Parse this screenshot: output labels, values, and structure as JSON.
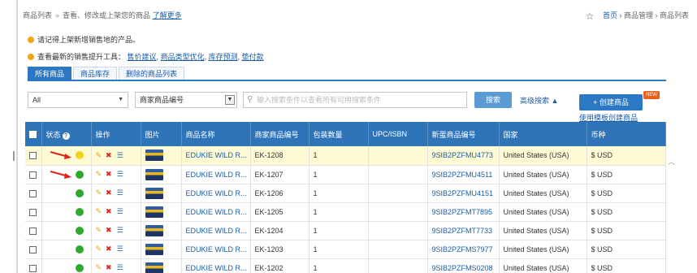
{
  "breadcrumb": {
    "section": "商品列表",
    "description": "查看、修改或上架您的商品",
    "learn_more": "了解更多",
    "home": "首页",
    "parent": "商品管理",
    "current": "商品列表"
  },
  "notices": {
    "first": "请记得上架新增销售地的产品。",
    "second_prefix": "查看最新的销售提升工具：",
    "links": [
      "售价建议",
      "商品类型优化",
      "库存预测",
      "垫付款"
    ]
  },
  "tabs": [
    {
      "label": "所有商品",
      "active": true
    },
    {
      "label": "商品库存",
      "active": false
    },
    {
      "label": "删除的商品列表",
      "active": false
    }
  ],
  "filters": {
    "scope_select": "All",
    "field_select": "商家商品编号",
    "search_placeholder": "输入搜索条件以查看所有可用搜索条件",
    "search_button": "搜索",
    "advanced_search": "高级搜索",
    "create_button": "创建商品",
    "new_badge": "NEW",
    "template_link": "使用模板创建商品"
  },
  "table": {
    "headers": [
      "",
      "状态",
      "操作",
      "图片",
      "商品名称",
      "商家商品编号",
      "包装数量",
      "UPC/ISBN",
      "新蛋商品编号",
      "国家",
      "币种"
    ],
    "rows": [
      {
        "status": "yellow",
        "arrow": true,
        "name": "EDUKIE WILD R...",
        "sku": "EK-1208",
        "qty": "1",
        "upc": "",
        "newegg": "9SIB2PZFMU4773",
        "country": "United States (USA)",
        "currency": "$ USD",
        "highlight": true
      },
      {
        "status": "green",
        "arrow": true,
        "name": "EDUKIE WILD R...",
        "sku": "EK-1207",
        "qty": "1",
        "upc": "",
        "newegg": "9SIB2PZFMU4511",
        "country": "United States (USA)",
        "currency": "$ USD",
        "highlight": false
      },
      {
        "status": "green",
        "arrow": false,
        "name": "EDUKIE WILD R...",
        "sku": "EK-1206",
        "qty": "1",
        "upc": "",
        "newegg": "9SIB2PZFMU4151",
        "country": "United States (USA)",
        "currency": "$ USD",
        "highlight": false
      },
      {
        "status": "green",
        "arrow": false,
        "name": "EDUKIE WILD R...",
        "sku": "EK-1205",
        "qty": "1",
        "upc": "",
        "newegg": "9SIB2PZFMT7895",
        "country": "United States (USA)",
        "currency": "$ USD",
        "highlight": false
      },
      {
        "status": "green",
        "arrow": false,
        "name": "EDUKIE WILD R...",
        "sku": "EK-1204",
        "qty": "1",
        "upc": "",
        "newegg": "9SIB2PZFMT7733",
        "country": "United States (USA)",
        "currency": "$ USD",
        "highlight": false
      },
      {
        "status": "green",
        "arrow": false,
        "name": "EDUKIE WILD R...",
        "sku": "EK-1203",
        "qty": "1",
        "upc": "",
        "newegg": "9SIB2PZFMS7977",
        "country": "United States (USA)",
        "currency": "$ USD",
        "highlight": false
      },
      {
        "status": "green",
        "arrow": false,
        "name": "EDUKIE WILD R...",
        "sku": "EK-1202",
        "qty": "1",
        "upc": "",
        "newegg": "9SIB2PZFMS0208",
        "country": "United States (USA)",
        "currency": "$ USD",
        "highlight": false
      }
    ]
  },
  "colors": {
    "accent": "#2f74b9",
    "link": "#1a5ca8",
    "status_green": "#2fa82f",
    "status_yellow": "#f5d31a",
    "arrow_red": "#e0241b",
    "highlight_row": "#fefbd4"
  },
  "icons": {
    "favorite": "star-outline-icon",
    "search": "magnifier-icon",
    "edit": "pencil-icon",
    "delete": "x-icon",
    "detail": "list-icon",
    "help": "question-circle-icon",
    "create": "plus-icon"
  }
}
